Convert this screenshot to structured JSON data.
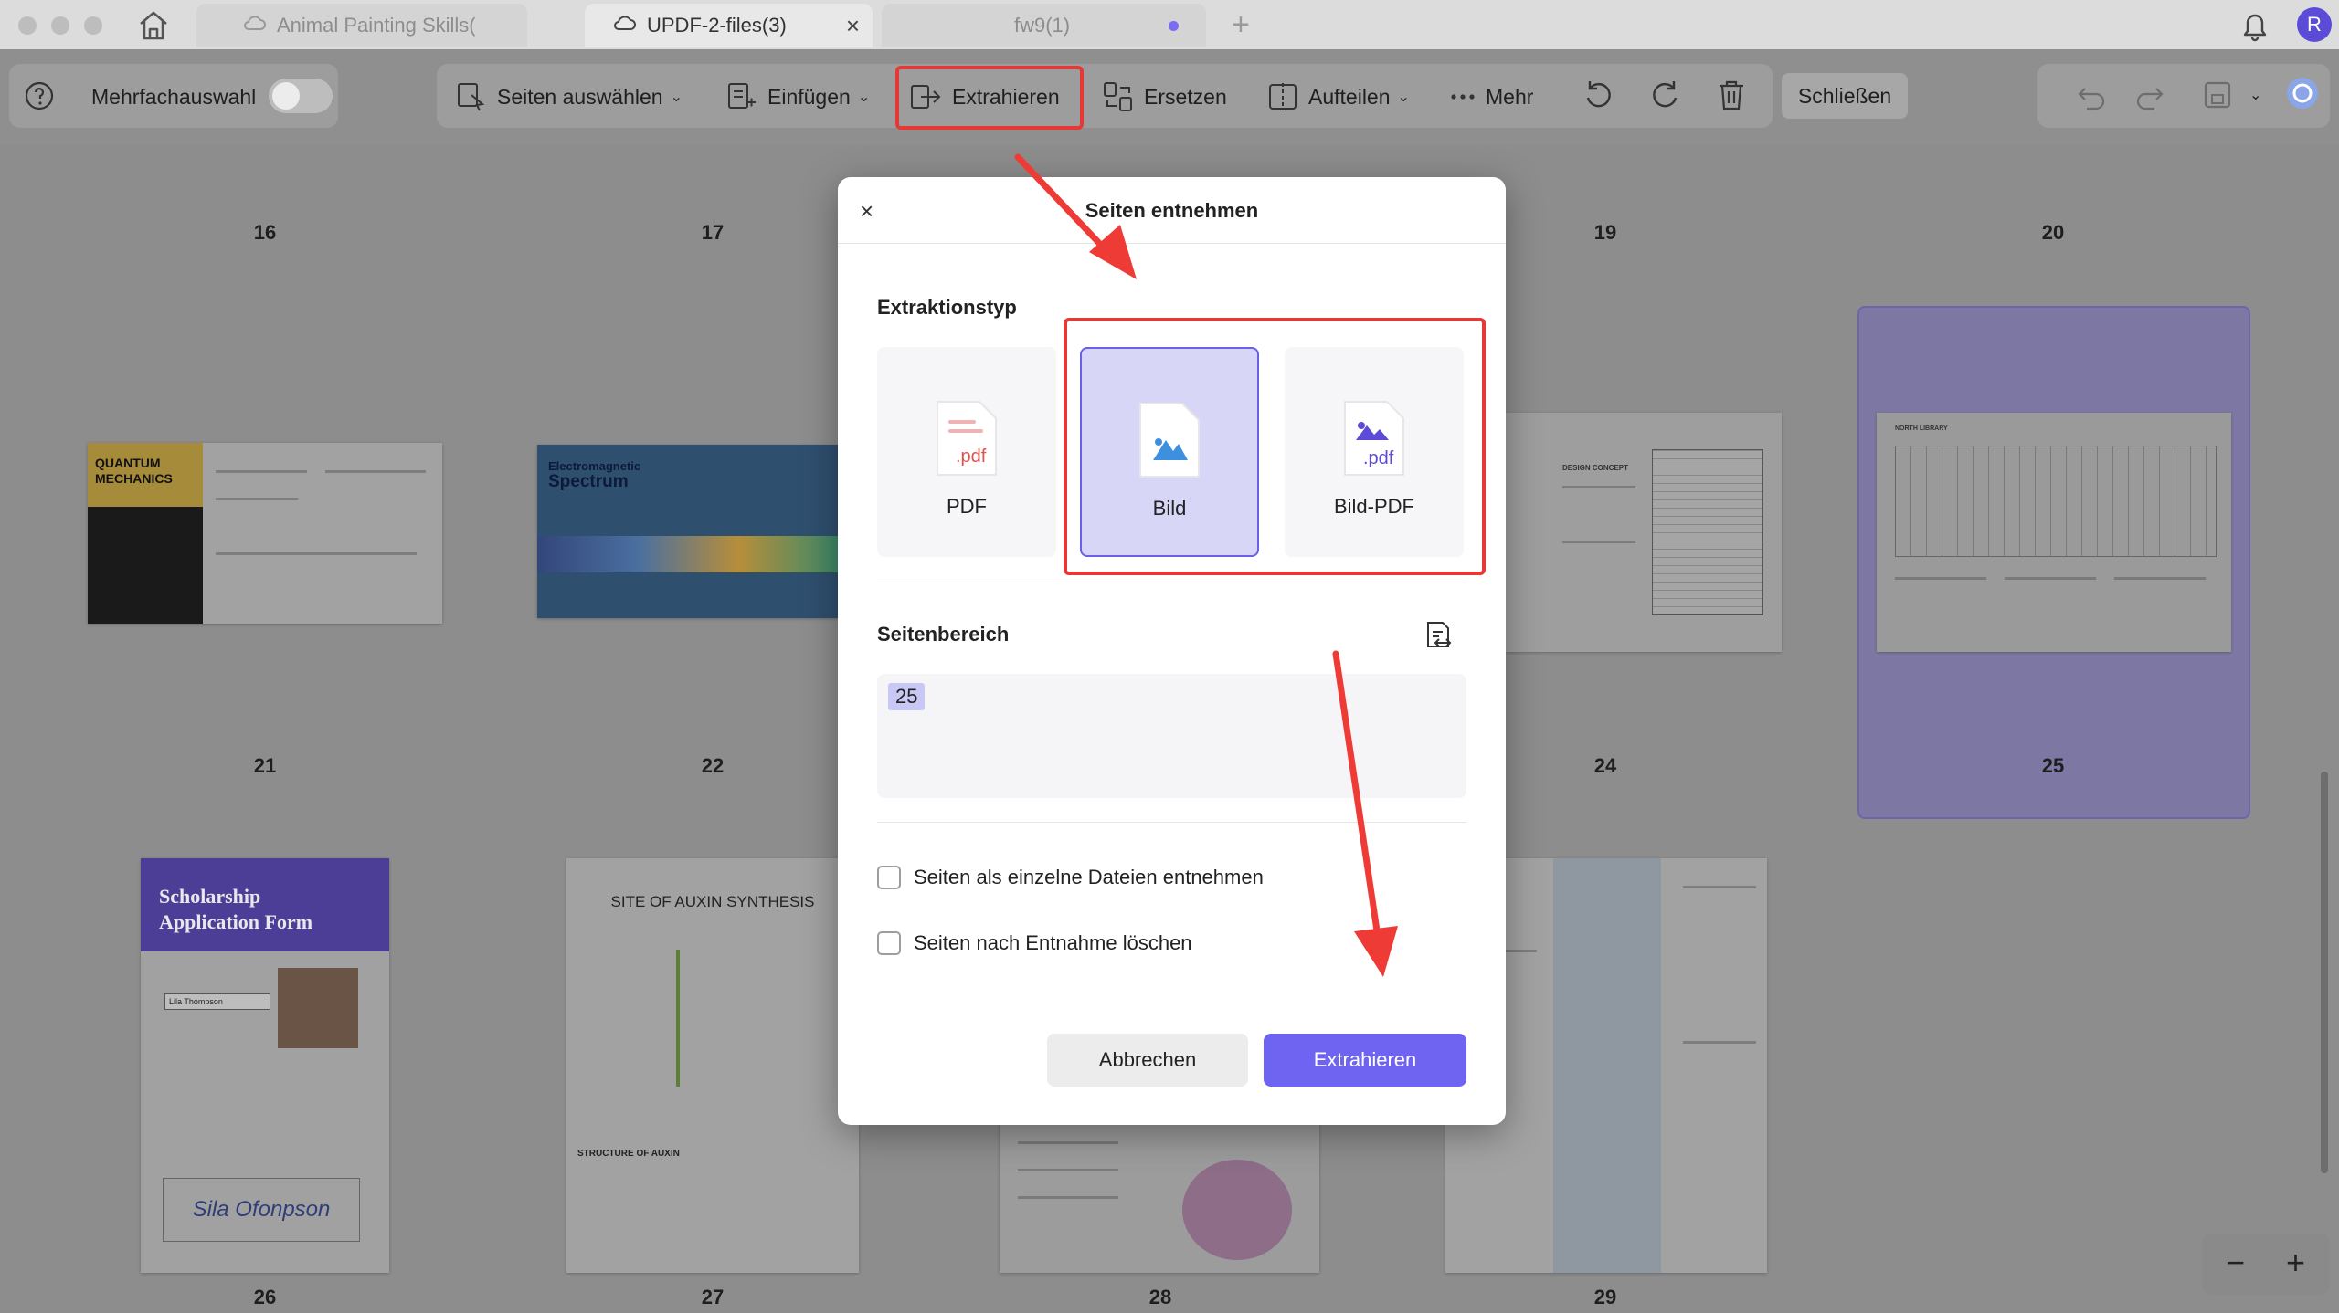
{
  "titlebar": {
    "tabs": [
      {
        "label": "Animal Painting Skills("
      },
      {
        "label": "UPDF-2-files(3)",
        "close": "×"
      },
      {
        "label": "fw9(1)"
      }
    ],
    "new_tab": "+",
    "avatar_initial": "R"
  },
  "toolbar": {
    "multi_select_label": "Mehrfachauswahl",
    "select_pages": "Seiten auswählen",
    "insert": "Einfügen",
    "extract": "Extrahieren",
    "replace": "Ersetzen",
    "split": "Aufteilen",
    "more": "Mehr",
    "close": "Schließen",
    "chevron": "⌄"
  },
  "pages": {
    "row1": [
      "16",
      "17",
      "19",
      "20"
    ],
    "row2": [
      "21",
      "22",
      "24",
      "25"
    ],
    "row3": [
      "26",
      "27",
      "28",
      "29"
    ],
    "thumb_texts": {
      "quantum": "QUANTUM MECHANICS",
      "spectrum_small": "Electromagnetic",
      "spectrum": "Spectrum",
      "scholarship": "Scholarship Application Form",
      "auxin": "SITE OF AUXIN SYNTHESIS",
      "structure": "STRUCTURE OF AUXIN",
      "signature": "Sila Ofonpson",
      "name_value": "Lila Thompson",
      "north_library": "NORTH LIBRARY",
      "design_concept": "DESIGN CONCEPT"
    }
  },
  "dialog": {
    "title": "Seiten entnehmen",
    "close": "×",
    "extraction_type_label": "Extraktionstyp",
    "options": [
      {
        "label": "PDF",
        "ext": ".pdf",
        "selected": false
      },
      {
        "label": "Bild",
        "ext": "",
        "selected": true
      },
      {
        "label": "Bild-PDF",
        "ext": ".pdf",
        "selected": false
      }
    ],
    "page_range_label": "Seitenbereich",
    "page_range_value": "25",
    "checkbox_separate": "Seiten als einzelne Dateien entnehmen",
    "checkbox_delete": "Seiten nach Entnahme löschen",
    "cancel": "Abbrechen",
    "extract": "Extrahieren"
  },
  "zoom": {
    "minus": "−",
    "plus": "+"
  },
  "colors": {
    "accent": "#6f63f1",
    "annotation_red": "#e53935",
    "selected_option_bg": "#d8d6f6"
  }
}
